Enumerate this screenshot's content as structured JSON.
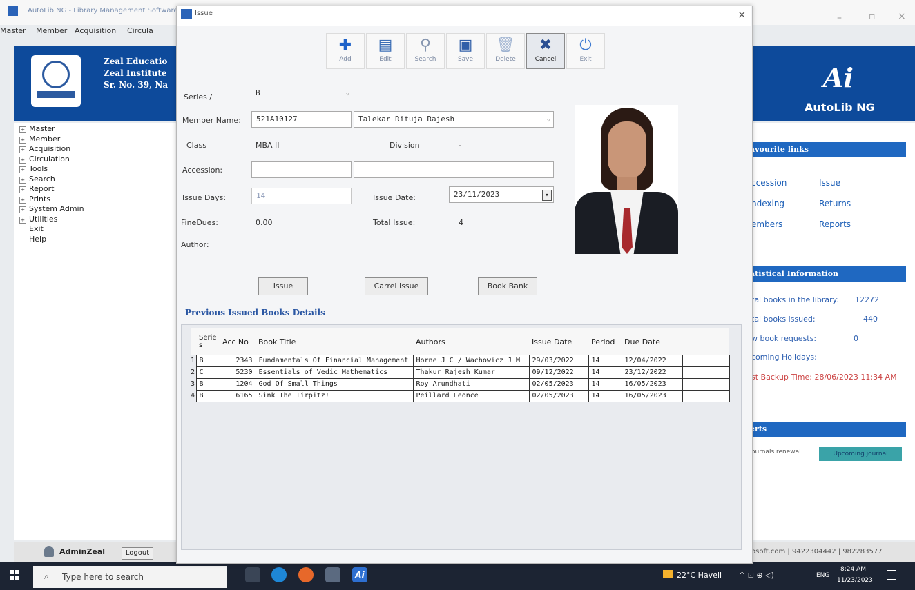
{
  "main_window": {
    "title": "AutoLib NG - Library Management Software",
    "menu": [
      "Master",
      "Member",
      "Acquisition",
      "Circula"
    ]
  },
  "banner": {
    "line1": "Zeal Educatio",
    "line2": "Zeal Institute",
    "line3": "Sr. No. 39, Na",
    "app_name": "AutoLib NG",
    "app_logo": "Ai"
  },
  "tree": {
    "items": [
      {
        "label": "Master",
        "expandable": true
      },
      {
        "label": "Member",
        "expandable": true
      },
      {
        "label": "Acquisition",
        "expandable": true
      },
      {
        "label": "Circulation",
        "expandable": true
      },
      {
        "label": "Tools",
        "expandable": true
      },
      {
        "label": "Search",
        "expandable": true
      },
      {
        "label": "Report",
        "expandable": true
      },
      {
        "label": "Prints",
        "expandable": true
      },
      {
        "label": "System Admin",
        "expandable": true
      },
      {
        "label": "Utilities",
        "expandable": true
      },
      {
        "label": "Exit",
        "expandable": false
      },
      {
        "label": "Help",
        "expandable": false
      }
    ]
  },
  "status": {
    "user": "AdminZeal",
    "logout": "Logout"
  },
  "right": {
    "favourite_header": "avourite links",
    "links": {
      "accession": "ccession",
      "issue": "Issue",
      "indexing": "ndexing",
      "returns": "Returns",
      "members": "embers",
      "reports": "Reports"
    },
    "stats_header": "atistical Information",
    "stats": [
      {
        "label": "tal books in the library:",
        "value": "12272"
      },
      {
        "label": "tal books issued:",
        "value": "440"
      },
      {
        "label": "w book requests:",
        "value": "0"
      },
      {
        "label": "coming Holidays:",
        "value": ""
      },
      {
        "label": "st Backup Time: 28/06/2023 11:34 AM",
        "value": ""
      }
    ],
    "alerts_header": "erts",
    "alert_text": "ournals renewal",
    "journal_button": "Upcoming journal",
    "footer": "osoft.com | 9422304442 | 982283577"
  },
  "taskbar": {
    "search_placeholder": "Type here to search",
    "weather": "22°C Haveli",
    "lang": "ENG",
    "time": "8:24 AM",
    "date": "11/23/2023"
  },
  "dialog": {
    "title": "Issue",
    "close": "×",
    "toolbar": {
      "add": "Add",
      "edit": "Edit",
      "search": "Search",
      "save": "Save",
      "delete": "Delete",
      "cancel": "Cancel",
      "exit": "Exit"
    },
    "form": {
      "series_label": "Series /",
      "series_value": "B",
      "member_name_label": "Member Name:",
      "member_id": "521A10127",
      "member_name": "Talekar Rituja Rajesh",
      "class_label": "Class",
      "class_value": "MBA II",
      "division_label": "Division",
      "division_value": "-",
      "accession_label": "Accession:",
      "accession_value": "",
      "accession_title": "",
      "issue_days_label": "Issue Days:",
      "issue_days_value": "14",
      "issue_date_label": "Issue Date:",
      "issue_date_value": "23/11/2023",
      "finedues_label": "FineDues:",
      "finedues_value": "0.00",
      "total_issue_label": "Total Issue:",
      "total_issue_value": "4",
      "author_label": "Author:",
      "author_value": ""
    },
    "actions": {
      "issue": "Issue",
      "carrel_issue": "Carrel Issue",
      "book_bank": "Book Bank"
    },
    "prev_title": "Previous Issued Books Details",
    "columns": [
      "Serie s",
      "Acc No",
      "Book Title",
      "Authors",
      "Issue Date",
      "Period",
      "Due Date"
    ],
    "rows": [
      {
        "n": "1",
        "series": "B",
        "acc": "2343",
        "title": "Fundamentals Of Financial Management",
        "authors": "Horne J C / Wachowicz J M",
        "issue": "29/03/2022",
        "period": "14",
        "due": "12/04/2022"
      },
      {
        "n": "2",
        "series": "C",
        "acc": "5230",
        "title": "Essentials of Vedic Mathematics",
        "authors": "Thakur Rajesh Kumar",
        "issue": "09/12/2022",
        "period": "14",
        "due": "23/12/2022"
      },
      {
        "n": "3",
        "series": "B",
        "acc": "1204",
        "title": "God Of Small Things",
        "authors": "Roy Arundhati",
        "issue": "02/05/2023",
        "period": "14",
        "due": "16/05/2023"
      },
      {
        "n": "4",
        "series": "B",
        "acc": "6165",
        "title": "Sink The Tirpitz!",
        "authors": "Peillard Leonce",
        "issue": "02/05/2023",
        "period": "14",
        "due": "16/05/2023"
      }
    ]
  }
}
